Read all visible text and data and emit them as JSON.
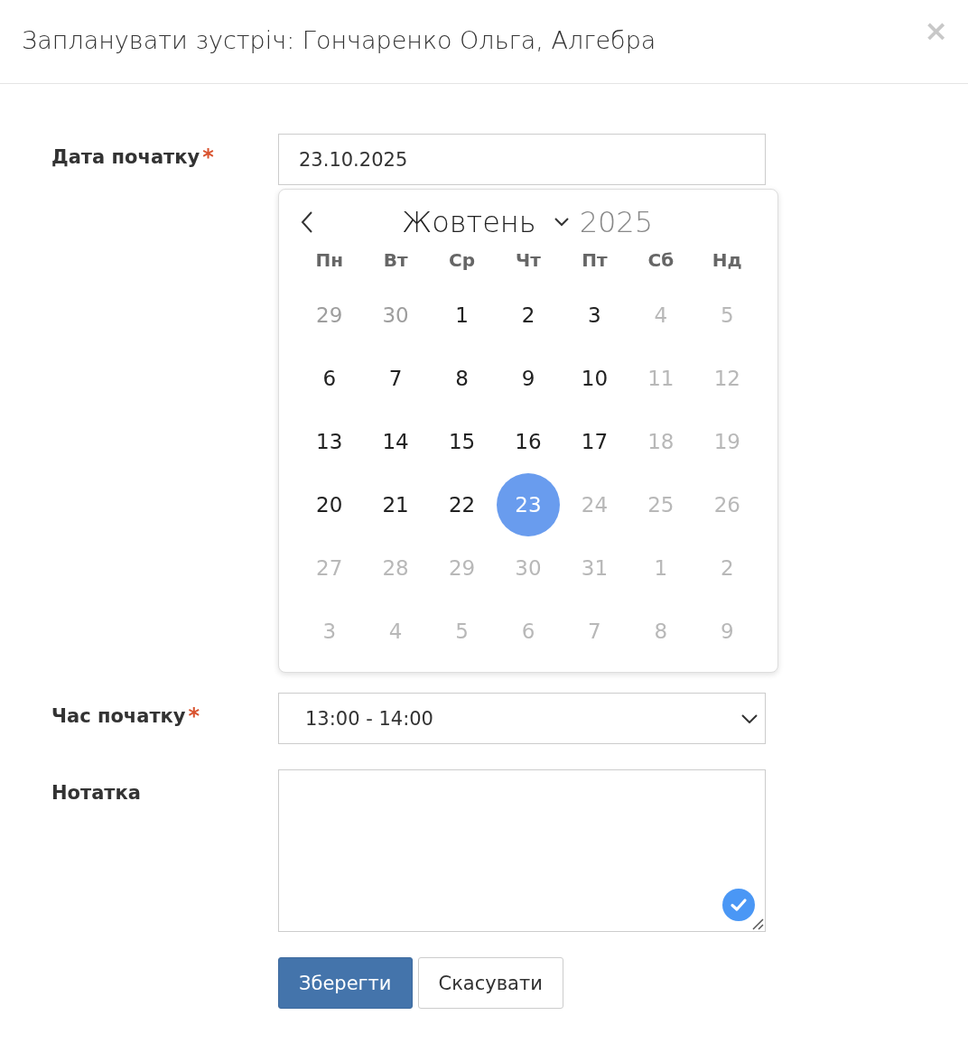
{
  "dialog": {
    "title": "Запланувати зустріч: Гончаренко Ольга, Алгебра",
    "close": "×"
  },
  "date_field": {
    "label": "Дата початку",
    "required": "*",
    "value": "23.10.2025"
  },
  "calendar": {
    "month": "Жовтень",
    "year": "2025",
    "weekdays": [
      "Пн",
      "Вт",
      "Ср",
      "Чт",
      "Пт",
      "Сб",
      "Нд"
    ],
    "days": [
      {
        "label": "29",
        "kind": "outside",
        "selected": false
      },
      {
        "label": "30",
        "kind": "outside",
        "selected": false
      },
      {
        "label": "1",
        "kind": "normal",
        "selected": false
      },
      {
        "label": "2",
        "kind": "normal",
        "selected": false
      },
      {
        "label": "3",
        "kind": "normal",
        "selected": false
      },
      {
        "label": "4",
        "kind": "disabled",
        "selected": false
      },
      {
        "label": "5",
        "kind": "disabled",
        "selected": false
      },
      {
        "label": "6",
        "kind": "normal",
        "selected": false
      },
      {
        "label": "7",
        "kind": "normal",
        "selected": false
      },
      {
        "label": "8",
        "kind": "normal",
        "selected": false
      },
      {
        "label": "9",
        "kind": "normal",
        "selected": false
      },
      {
        "label": "10",
        "kind": "normal",
        "selected": false
      },
      {
        "label": "11",
        "kind": "disabled",
        "selected": false
      },
      {
        "label": "12",
        "kind": "disabled",
        "selected": false
      },
      {
        "label": "13",
        "kind": "normal",
        "selected": false
      },
      {
        "label": "14",
        "kind": "normal",
        "selected": false
      },
      {
        "label": "15",
        "kind": "normal",
        "selected": false
      },
      {
        "label": "16",
        "kind": "normal",
        "selected": false
      },
      {
        "label": "17",
        "kind": "normal",
        "selected": false
      },
      {
        "label": "18",
        "kind": "disabled",
        "selected": false
      },
      {
        "label": "19",
        "kind": "disabled",
        "selected": false
      },
      {
        "label": "20",
        "kind": "normal",
        "selected": false
      },
      {
        "label": "21",
        "kind": "normal",
        "selected": false
      },
      {
        "label": "22",
        "kind": "normal",
        "selected": false
      },
      {
        "label": "23",
        "kind": "normal",
        "selected": true
      },
      {
        "label": "24",
        "kind": "disabled",
        "selected": false
      },
      {
        "label": "25",
        "kind": "disabled",
        "selected": false
      },
      {
        "label": "26",
        "kind": "disabled",
        "selected": false
      },
      {
        "label": "27",
        "kind": "disabled",
        "selected": false
      },
      {
        "label": "28",
        "kind": "disabled",
        "selected": false
      },
      {
        "label": "29",
        "kind": "disabled",
        "selected": false
      },
      {
        "label": "30",
        "kind": "disabled",
        "selected": false
      },
      {
        "label": "31",
        "kind": "disabled",
        "selected": false
      },
      {
        "label": "1",
        "kind": "disabled",
        "selected": false
      },
      {
        "label": "2",
        "kind": "disabled",
        "selected": false
      },
      {
        "label": "3",
        "kind": "disabled",
        "selected": false
      },
      {
        "label": "4",
        "kind": "disabled",
        "selected": false
      },
      {
        "label": "5",
        "kind": "disabled",
        "selected": false
      },
      {
        "label": "6",
        "kind": "disabled",
        "selected": false
      },
      {
        "label": "7",
        "kind": "disabled",
        "selected": false
      },
      {
        "label": "8",
        "kind": "disabled",
        "selected": false
      },
      {
        "label": "9",
        "kind": "disabled",
        "selected": false
      }
    ]
  },
  "time_field": {
    "label": "Час початку",
    "required": "*",
    "value": "13:00 - 14:00"
  },
  "note_field": {
    "label": "Нотатка"
  },
  "buttons": [
    {
      "label": "Зберегти",
      "kind": "primary"
    },
    {
      "label": "Скасувати",
      "kind": "secondary"
    }
  ]
}
